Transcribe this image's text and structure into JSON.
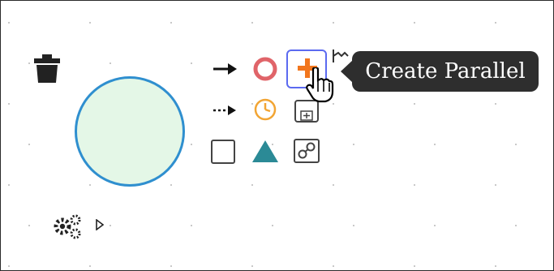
{
  "tooltip": {
    "text": "Create Parallel"
  },
  "colors": {
    "event_stroke": "#2f8fcf",
    "event_fill": "#e4f7e7",
    "end_event": "#e06469",
    "parallel_plus": "#f2761d",
    "timer": "#f2a534",
    "gateway": "#2b8a96",
    "hover_border": "#5b6af0",
    "tooltip_bg": "#2e2e2e"
  },
  "icons": [
    "delete-icon",
    "start-event-shape",
    "settings-gear-icon",
    "expand-triangle-icon",
    "sequence-flow-arrow-icon",
    "end-event-icon",
    "parallel-plus-icon",
    "annotation-icon",
    "message-flow-arrow-icon",
    "timer-event-icon",
    "subprocess-icon",
    "task-icon",
    "gateway-triangle-icon",
    "link-icon",
    "pointer-hand-icon"
  ]
}
